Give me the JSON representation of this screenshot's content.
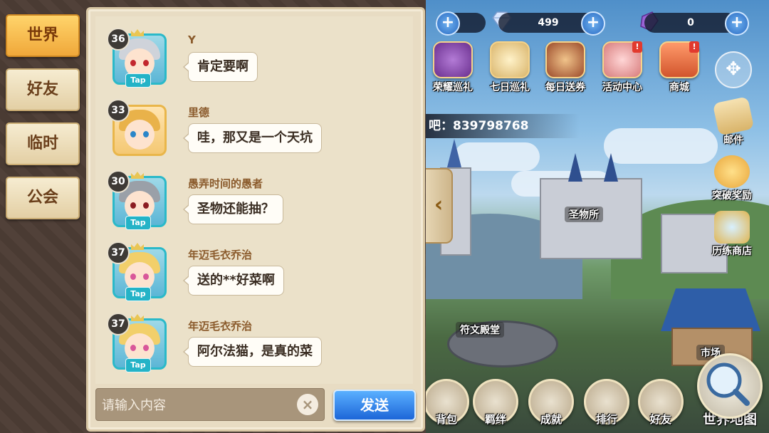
{
  "resources": {
    "first_value": "",
    "diamond_value": "499",
    "crystal_value": "0"
  },
  "events": [
    {
      "label": "荣耀巡礼",
      "icon": "honor-tour-icon",
      "badge": ""
    },
    {
      "label": "七日巡礼",
      "icon": "seven-day-tour-icon",
      "badge": ""
    },
    {
      "label": "每日送券",
      "icon": "daily-ticket-icon",
      "badge": ""
    },
    {
      "label": "活动中心",
      "icon": "event-center-icon",
      "badge": "!"
    },
    {
      "label": "商城",
      "icon": "shop-icon",
      "badge": "!"
    }
  ],
  "qq_group": "吧：839798768",
  "side": {
    "mail": "邮件",
    "breakthrough": "突破奖励",
    "trial_shop": "历练商店"
  },
  "places": {
    "relic_hall": "圣物所",
    "rune_temple": "符文殿堂",
    "market": "市场"
  },
  "bottom_menu": [
    {
      "label": "背包",
      "icon": "backpack-icon"
    },
    {
      "label": "羁绊",
      "icon": "bond-icon"
    },
    {
      "label": "成就",
      "icon": "achievement-icon"
    },
    {
      "label": "排行",
      "icon": "ranking-icon"
    },
    {
      "label": "好友",
      "icon": "friends-icon"
    }
  ],
  "world_map": "世界地图",
  "chat": {
    "tabs": [
      "世界",
      "好友",
      "临时",
      "公会"
    ],
    "active_tab": "世界",
    "messages": [
      {
        "level": "36",
        "name": "Y",
        "text": "肯定要啊",
        "tap": "Tap",
        "frame": "teal"
      },
      {
        "level": "33",
        "name": "里德",
        "text": "哇，那又是一个天坑",
        "tap": "",
        "frame": "gold"
      },
      {
        "level": "30",
        "name": "愚弄时间的愚者",
        "text": "圣物还能抽？",
        "tap": "Tap",
        "frame": "teal"
      },
      {
        "level": "37",
        "name": "年迈毛衣乔治",
        "text": "送的**好菜啊",
        "tap": "Tap",
        "frame": "teal"
      },
      {
        "level": "37",
        "name": "年迈毛衣乔治",
        "text": "阿尔法猫，是真的菜",
        "tap": "Tap",
        "frame": "teal"
      }
    ],
    "input_placeholder": "请输入内容",
    "clear_label": "×",
    "send_label": "发送",
    "collapse_label": "‹"
  }
}
